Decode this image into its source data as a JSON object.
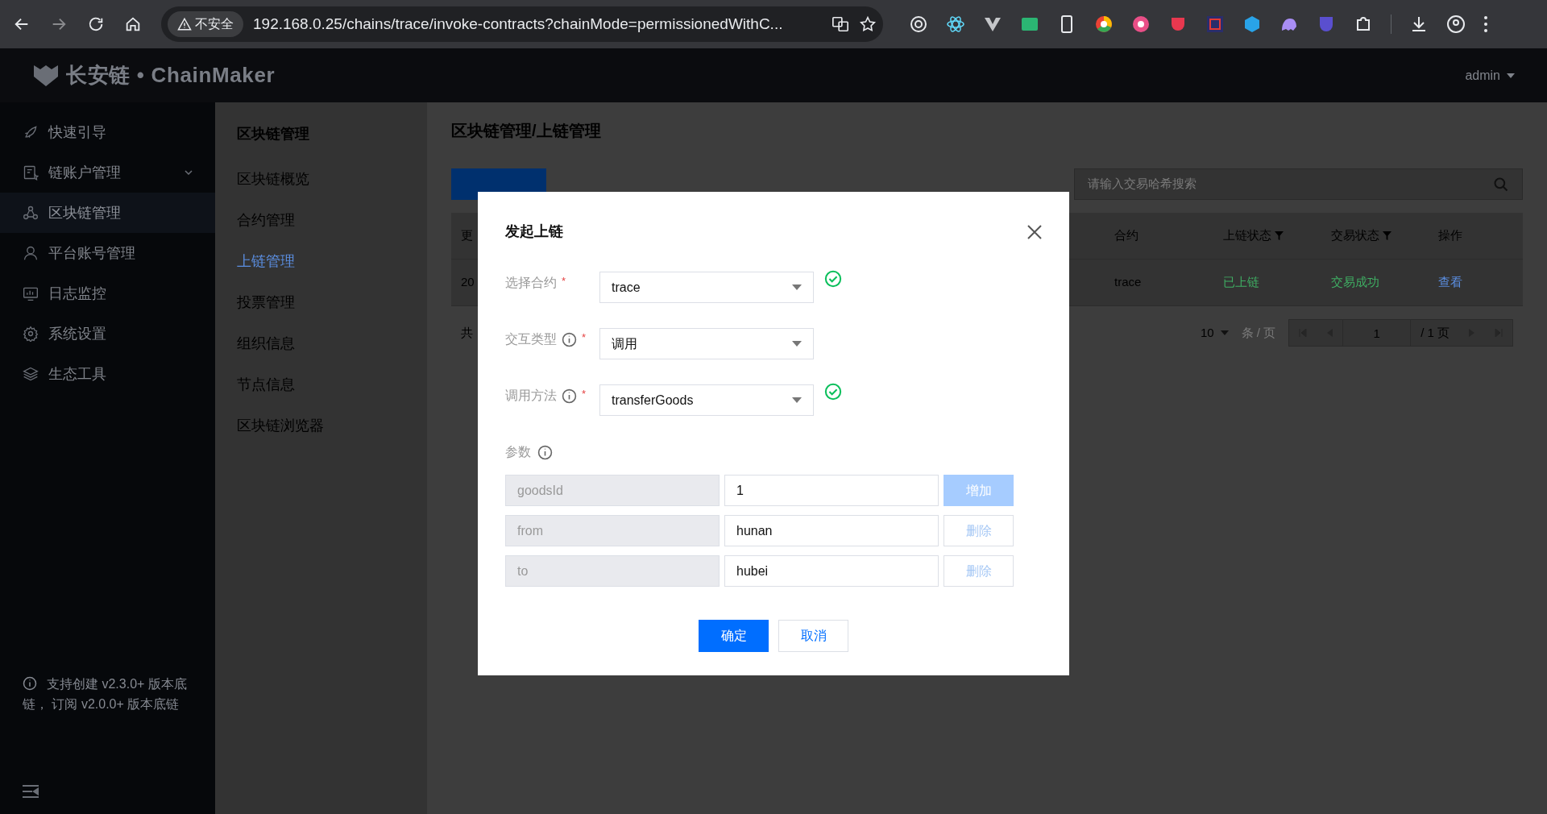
{
  "browser": {
    "security_label": "不安全",
    "url": "192.168.0.25/chains/trace/invoke-contracts?chainMode=permissionedWithC..."
  },
  "header": {
    "logo_text": "长安链 • ChainMaker",
    "user": "admin"
  },
  "sidebar": {
    "items": [
      {
        "label": "快速引导",
        "selected": false,
        "has_submenu": false
      },
      {
        "label": "链账户管理",
        "selected": false,
        "has_submenu": true
      },
      {
        "label": "区块链管理",
        "selected": true,
        "has_submenu": false
      },
      {
        "label": "平台账号管理",
        "selected": false,
        "has_submenu": false
      },
      {
        "label": "日志监控",
        "selected": false,
        "has_submenu": false
      },
      {
        "label": "系统设置",
        "selected": false,
        "has_submenu": false
      },
      {
        "label": "生态工具",
        "selected": false,
        "has_submenu": false
      }
    ],
    "notice": "支持创建 v2.3.0+ 版本底链， 订阅 v2.0.0+ 版本底链"
  },
  "subnav": {
    "title": "区块链管理",
    "items": [
      {
        "label": "区块链概览",
        "selected": false
      },
      {
        "label": "合约管理",
        "selected": false
      },
      {
        "label": "上链管理",
        "selected": true
      },
      {
        "label": "投票管理",
        "selected": false
      },
      {
        "label": "组织信息",
        "selected": false
      },
      {
        "label": "节点信息",
        "selected": false
      },
      {
        "label": "区块链浏览器",
        "selected": false
      }
    ]
  },
  "page": {
    "title": "区块链管理/上链管理",
    "search": {
      "placeholder": "请输入交易哈希搜索"
    },
    "table": {
      "columns": [
        {
          "label": "更",
          "filter": false
        },
        {
          "label": "合约",
          "filter": false
        },
        {
          "label": "上链状态",
          "filter": true
        },
        {
          "label": "交易状态",
          "filter": true
        },
        {
          "label": "操作",
          "filter": false
        }
      ],
      "rows": [
        {
          "cells": [
            {
              "text": "20",
              "kind": "text"
            },
            {
              "text": "trace",
              "kind": "text"
            },
            {
              "text": "已上链",
              "kind": "status"
            },
            {
              "text": "交易成功",
              "kind": "status"
            },
            {
              "text": "查看",
              "kind": "link"
            }
          ]
        }
      ]
    },
    "pagination": {
      "total_label": "共",
      "page_size": "10",
      "unit": "条 / 页",
      "page": "1",
      "total_pages": "/ 1 页"
    }
  },
  "dialog": {
    "title": "发起上链",
    "fields": [
      {
        "label": "选择合约",
        "info": false,
        "required": true,
        "required_mark": "*",
        "value": "trace",
        "valid": true
      },
      {
        "label": "交互类型",
        "info": true,
        "required": true,
        "required_mark": "*",
        "value": "调用",
        "valid": false
      },
      {
        "label": "调用方法",
        "info": true,
        "required": true,
        "required_mark": "*",
        "value": "transferGoods",
        "valid": true
      }
    ],
    "params_label": "参数",
    "params": [
      {
        "key": "goodsId",
        "value": "1",
        "action": {
          "label": "增加",
          "kind": "add"
        }
      },
      {
        "key": "from",
        "value": "hunan",
        "action": {
          "label": "删除",
          "kind": "remove"
        }
      },
      {
        "key": "to",
        "value": "hubei",
        "action": {
          "label": "删除",
          "kind": "remove"
        }
      }
    ],
    "buttons": [
      {
        "label": "确定",
        "kind": "primary"
      },
      {
        "label": "取消",
        "kind": "default"
      }
    ]
  }
}
